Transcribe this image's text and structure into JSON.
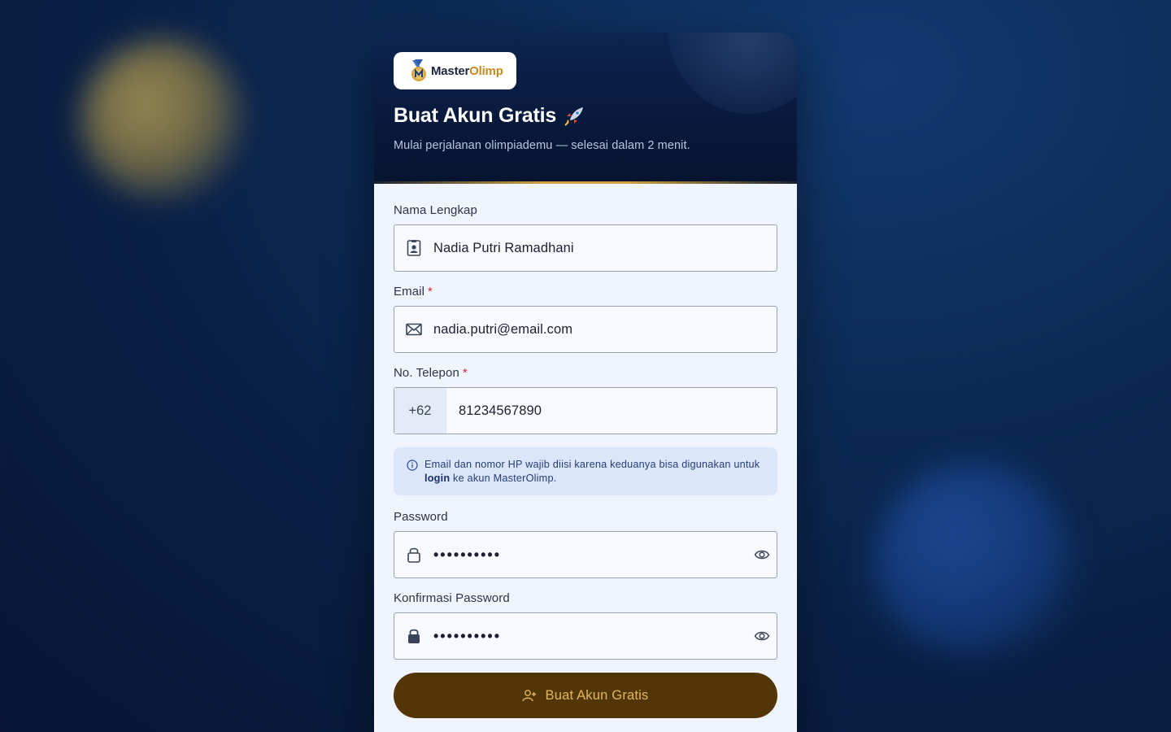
{
  "brand": {
    "name_part1": "Master",
    "name_part2": "Olimp"
  },
  "header": {
    "title": "Buat Akun Gratis",
    "subtitle": "Mulai perjalanan olimpiademu — selesai dalam 2 menit."
  },
  "form": {
    "full_name": {
      "label": "Nama Lengkap",
      "value": "Nadia Putri Ramadhani",
      "icon": "id-badge-icon"
    },
    "email": {
      "label": "Email",
      "required_mark": "*",
      "value": "nadia.putri@email.com",
      "icon": "envelope-icon"
    },
    "phone": {
      "label": "No. Telepon",
      "required_mark": "*",
      "prefix": "+62",
      "value": "81234567890"
    },
    "info": {
      "text_before": "Email dan nomor HP wajib diisi karena keduanya bisa digunakan untuk ",
      "bold": "login",
      "text_after": " ke akun MasterOlimp."
    },
    "password": {
      "label": "Password",
      "value_masked": "••••••••••",
      "icon": "lock-outline-icon"
    },
    "confirm_password": {
      "label": "Konfirmasi Password",
      "value_masked": "••••••••••",
      "icon": "lock-filled-icon"
    },
    "submit_label": "Buat Akun Gratis"
  },
  "colors": {
    "accent_gold": "#d2a03c",
    "button_bg": "#523607",
    "button_text": "#e2b75a",
    "required": "#d0283a",
    "info_bg": "#dce6fb"
  }
}
